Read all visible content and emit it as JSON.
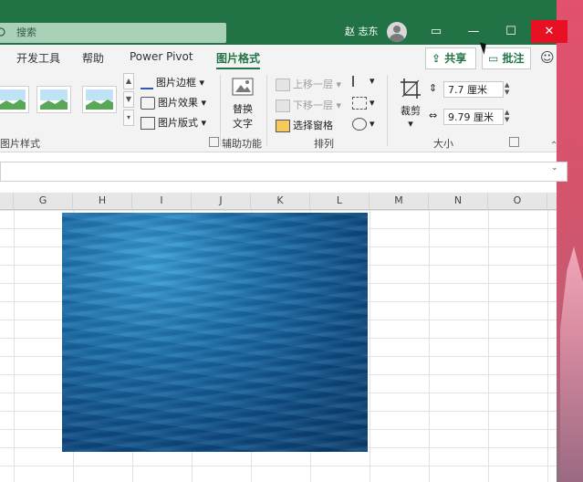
{
  "titlebar": {
    "search_placeholder": "搜索",
    "user_name": "赵 志东",
    "buttons": {
      "ribbon_display": "▭",
      "minimize": "—",
      "maximize": "☐",
      "close": "✕"
    }
  },
  "tabs": [
    {
      "label": "开发工具"
    },
    {
      "label": "帮助"
    },
    {
      "label": "Power Pivot"
    },
    {
      "label": "图片格式",
      "active": true
    }
  ],
  "share_label": "共享",
  "comment_label": "批注",
  "ribbon": {
    "styles_group": {
      "label": "图片样式"
    },
    "picture_commands": [
      {
        "label": "图片边框 ▾"
      },
      {
        "label": "图片效果 ▾"
      },
      {
        "label": "图片版式 ▾"
      }
    ],
    "alt_text": {
      "line1": "替换",
      "line2": "文字",
      "group_label": "辅助功能"
    },
    "arrange": {
      "bring_forward": "上移一层",
      "send_backward": "下移一层",
      "selection_pane": "选择窗格",
      "group_label": "排列"
    },
    "crop_label": "裁剪",
    "size": {
      "height_value": "7.7 厘米",
      "width_value": "9.79 厘米",
      "group_label": "大小"
    }
  },
  "columns": [
    "G",
    "H",
    "I",
    "J",
    "K",
    "L",
    "M",
    "N",
    "O"
  ],
  "colors": {
    "excel_green": "#217346",
    "close_red": "#e81123"
  }
}
